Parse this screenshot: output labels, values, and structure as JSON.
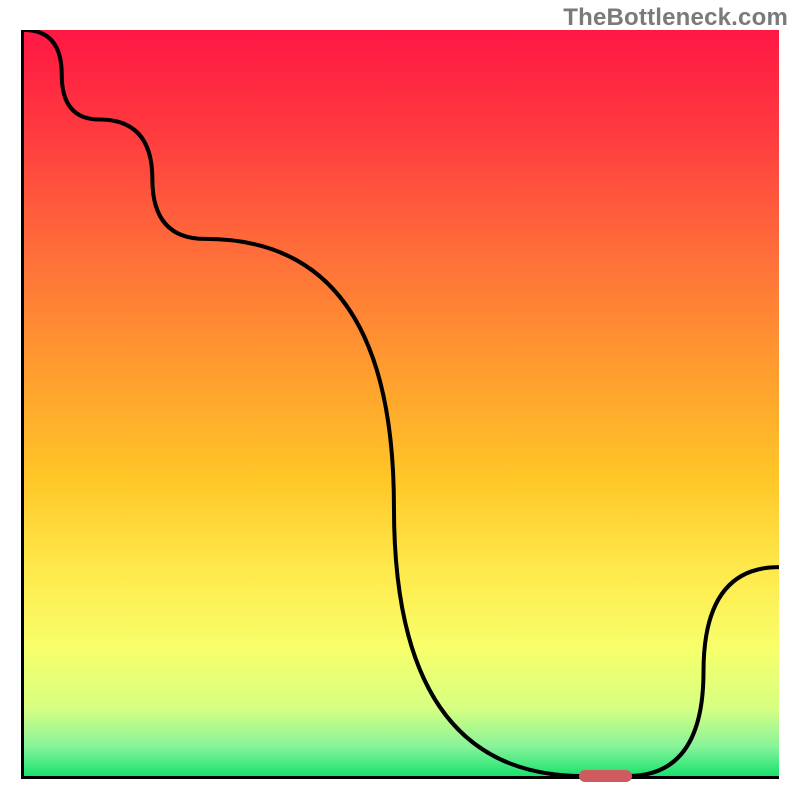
{
  "watermark": "TheBottleneck.com",
  "chart_data": {
    "type": "line",
    "title": "",
    "xlabel": "",
    "ylabel": "",
    "ylim": [
      0,
      100
    ],
    "xlim": [
      0,
      100
    ],
    "x": [
      0,
      10,
      24,
      74,
      80,
      100
    ],
    "values": [
      100,
      88,
      72,
      0,
      0,
      28
    ],
    "background_gradient_stops": [
      {
        "offset": 0.0,
        "color": "#ff1744"
      },
      {
        "offset": 0.14,
        "color": "#ff3b3f"
      },
      {
        "offset": 0.3,
        "color": "#ff6e3a"
      },
      {
        "offset": 0.45,
        "color": "#ff9b2f"
      },
      {
        "offset": 0.6,
        "color": "#ffc627"
      },
      {
        "offset": 0.72,
        "color": "#ffe84a"
      },
      {
        "offset": 0.83,
        "color": "#f7ff6b"
      },
      {
        "offset": 0.91,
        "color": "#d6ff82"
      },
      {
        "offset": 0.96,
        "color": "#88f39a"
      },
      {
        "offset": 1.0,
        "color": "#19e36e"
      }
    ],
    "marker": {
      "x_start": 74,
      "x_end": 80,
      "y": 0,
      "color": "#cf5b5f"
    },
    "note": "Values are approximate readings of the black curve height as percentage of the plot's vertical extent. The curve descends from top-left, reaches a flat minimum around x≈74–80, then rises toward the right edge."
  }
}
